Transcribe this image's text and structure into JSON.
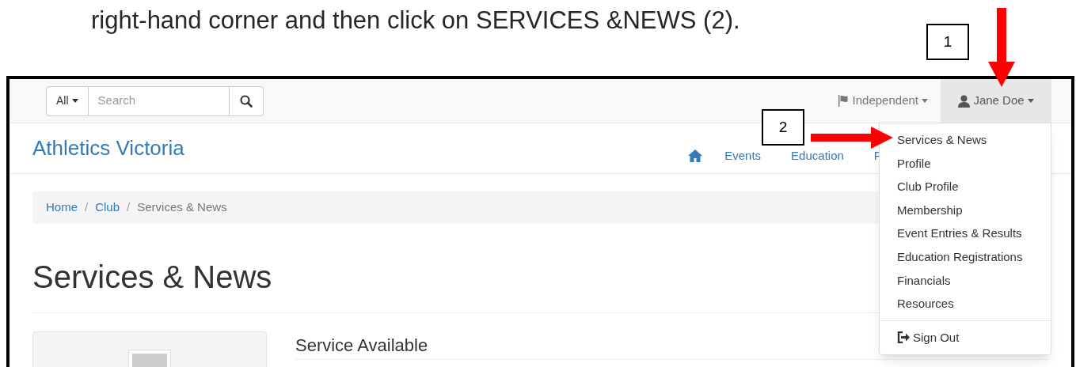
{
  "instruction": "right-hand corner and then click on SERVICES &NEWS (2).",
  "callouts": [
    {
      "label": "1"
    },
    {
      "label": "2"
    }
  ],
  "topbar": {
    "search_scope": "All",
    "search": {
      "placeholder": "Search"
    },
    "org_menu": "Independent",
    "user_menu": {
      "label": "Jane Doe",
      "expanded": true
    }
  },
  "brand": "Athletics Victoria",
  "nav": [
    "Events",
    "Education",
    "F"
  ],
  "breadcrumb": {
    "separator": "/",
    "items": [
      {
        "label": "Home",
        "link": true
      },
      {
        "label": "Club",
        "link": true
      },
      {
        "label": "Services & News",
        "link": false
      }
    ]
  },
  "title": "Services & News",
  "section_heading": "Service Available",
  "dropdown": {
    "items": [
      "Services & News",
      "Profile",
      "Club Profile",
      "Membership",
      "Event Entries & Results",
      "Education Registrations",
      "Financials",
      "Resources"
    ],
    "sign_out": "Sign Out"
  }
}
